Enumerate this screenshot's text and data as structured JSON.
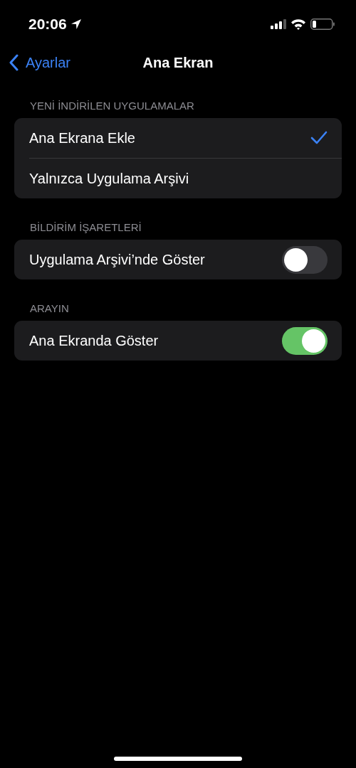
{
  "status_bar": {
    "time": "20:06"
  },
  "nav": {
    "back": "Ayarlar",
    "title": "Ana Ekran"
  },
  "sections": [
    {
      "header": "YENİ İNDİRİLEN UYGULAMALAR",
      "rows": [
        {
          "kind": "choice",
          "label": "Ana Ekrana Ekle",
          "selected": true
        },
        {
          "kind": "choice",
          "label": "Yalnızca Uygulama Arşivi",
          "selected": false
        }
      ]
    },
    {
      "header": "BİLDİRİM İŞARETLERİ",
      "rows": [
        {
          "kind": "toggle",
          "label": "Uygulama Arşivi’nde Göster",
          "on": false
        }
      ]
    },
    {
      "header": "ARAYIN",
      "rows": [
        {
          "kind": "toggle",
          "label": "Ana Ekranda Göster",
          "on": true
        }
      ]
    }
  ]
}
